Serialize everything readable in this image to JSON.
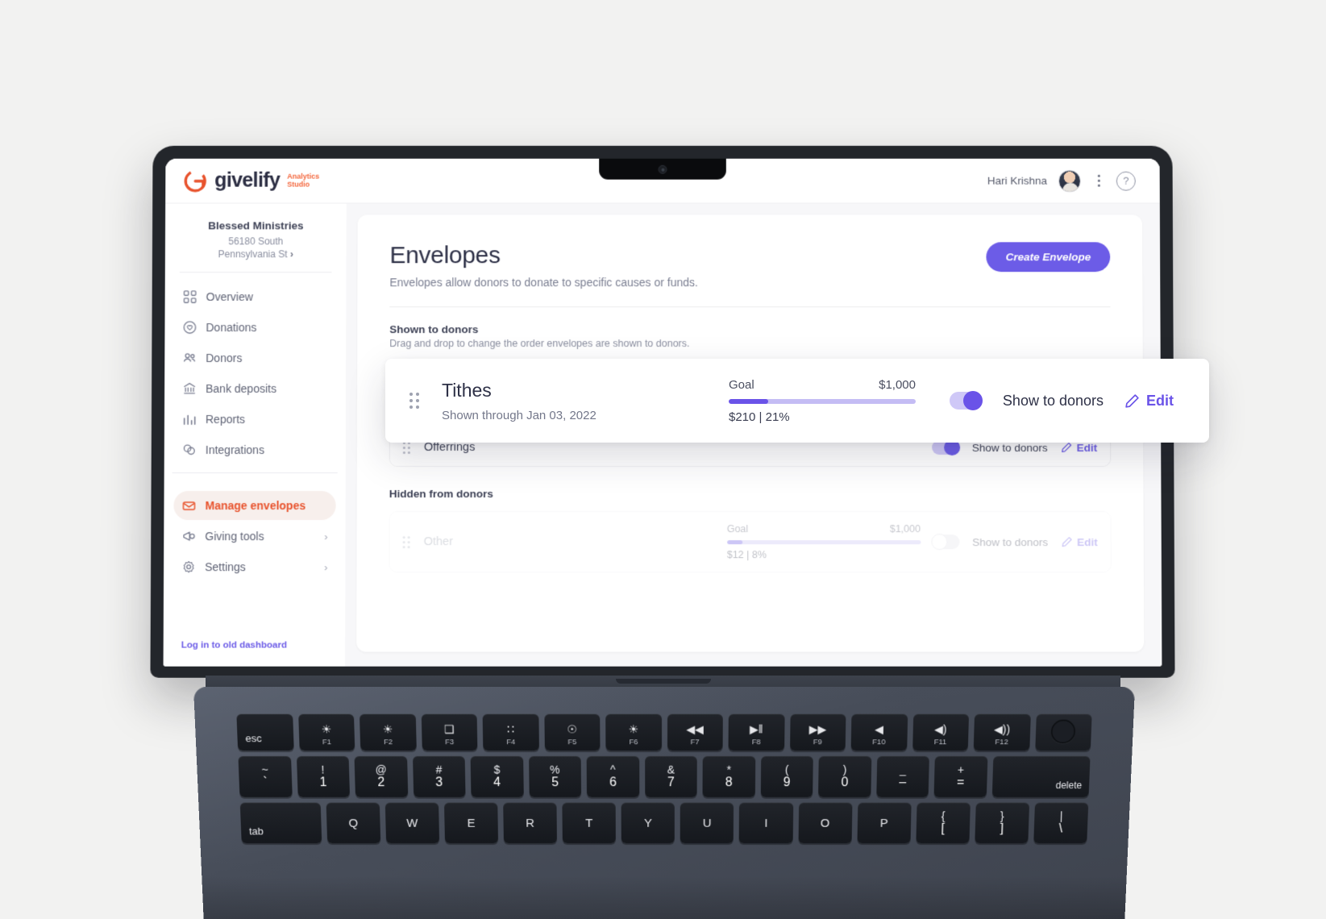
{
  "header": {
    "brand_word": "givelify",
    "brand_sub_line1": "Analytics",
    "brand_sub_line2": "Studio",
    "user_name": "Hari Krishna",
    "avatar_alt": "user-avatar",
    "kebab_label": "More options",
    "help_label": "?"
  },
  "sidebar": {
    "org_name": "Blessed Ministries",
    "org_address_line1": "56180 South",
    "org_address_line2": "Pennsylvania St",
    "org_chevron": "›",
    "items": [
      {
        "label": "Overview",
        "icon": "grid-icon",
        "active": false,
        "chevron": ""
      },
      {
        "label": "Donations",
        "icon": "heart-circle-icon",
        "active": false,
        "chevron": ""
      },
      {
        "label": "Donors",
        "icon": "people-icon",
        "active": false,
        "chevron": ""
      },
      {
        "label": "Bank deposits",
        "icon": "bank-icon",
        "active": false,
        "chevron": ""
      },
      {
        "label": "Reports",
        "icon": "bar-chart-icon",
        "active": false,
        "chevron": ""
      },
      {
        "label": "Integrations",
        "icon": "circles-icon",
        "active": false,
        "chevron": ""
      }
    ],
    "items2": [
      {
        "label": "Manage envelopes",
        "icon": "envelope-icon",
        "active": true,
        "chevron": ""
      },
      {
        "label": "Giving tools",
        "icon": "megaphone-icon",
        "active": false,
        "chevron": "›"
      },
      {
        "label": "Settings",
        "icon": "gear-icon",
        "active": false,
        "chevron": "›"
      }
    ],
    "old_dashboard_link": "Log in to old dashboard"
  },
  "main": {
    "title": "Envelopes",
    "subtitle": "Envelopes allow donors to donate to specific causes or funds.",
    "create_button": "Create Envelope",
    "shown_section": {
      "title": "Shown to donors",
      "subtitle": "Drag and drop to change the order envelopes are shown to donors."
    },
    "hidden_section": {
      "title": "Hidden from donors"
    },
    "rows_shown": [
      {
        "name": "Offerrings",
        "sub": "",
        "goal_label": "",
        "goal_amount": "",
        "progress_text": "",
        "progress_pct": 0,
        "toggle_on": true,
        "toggle_label": "Show to donors",
        "edit_label": "Edit"
      }
    ],
    "rows_hidden": [
      {
        "name": "Other",
        "sub": "",
        "goal_label": "Goal",
        "goal_amount": "$1,000",
        "progress_text": "$12 | 8%",
        "progress_pct": 8,
        "toggle_on": false,
        "toggle_label": "Show to donors",
        "edit_label": "Edit"
      }
    ]
  },
  "float_card": {
    "name": "Tithes",
    "sub": "Shown through Jan 03, 2022",
    "goal_label": "Goal",
    "goal_amount": "$1,000",
    "progress_text": "$210 | 21%",
    "progress_pct": 21,
    "toggle_on": true,
    "toggle_label": "Show to donors",
    "edit_label": "Edit"
  },
  "colors": {
    "accent_purple": "#6c5ce7",
    "brand_orange": "#e8532d",
    "progress_track": "#c4bcf4"
  },
  "keyboard": {
    "fn_row": [
      {
        "main": "esc",
        "sub": "",
        "glyph": "",
        "style": "text-left"
      },
      {
        "main": "",
        "sub": "F1",
        "glyph": "☀",
        "style": "glyph"
      },
      {
        "main": "",
        "sub": "F2",
        "glyph": "☀",
        "style": "glyph"
      },
      {
        "main": "",
        "sub": "F3",
        "glyph": "❑",
        "style": "glyph"
      },
      {
        "main": "",
        "sub": "F4",
        "glyph": "∷",
        "style": "glyph"
      },
      {
        "main": "",
        "sub": "F5",
        "glyph": "☉",
        "style": "glyph"
      },
      {
        "main": "",
        "sub": "F6",
        "glyph": "☀",
        "style": "glyph"
      },
      {
        "main": "",
        "sub": "F7",
        "glyph": "◀◀",
        "style": "glyph"
      },
      {
        "main": "",
        "sub": "F8",
        "glyph": "▶‖",
        "style": "glyph"
      },
      {
        "main": "",
        "sub": "F9",
        "glyph": "▶▶",
        "style": "glyph"
      },
      {
        "main": "",
        "sub": "F10",
        "glyph": "◀",
        "style": "glyph"
      },
      {
        "main": "",
        "sub": "F11",
        "glyph": "◀)",
        "style": "glyph"
      },
      {
        "main": "",
        "sub": "F12",
        "glyph": "◀))",
        "style": "glyph"
      },
      {
        "main": "",
        "sub": "",
        "glyph": "",
        "style": "touchid"
      }
    ],
    "num_row": [
      {
        "up": "~",
        "dn": "`"
      },
      {
        "up": "!",
        "dn": "1"
      },
      {
        "up": "@",
        "dn": "2"
      },
      {
        "up": "#",
        "dn": "3"
      },
      {
        "up": "$",
        "dn": "4"
      },
      {
        "up": "%",
        "dn": "5"
      },
      {
        "up": "^",
        "dn": "6"
      },
      {
        "up": "&",
        "dn": "7"
      },
      {
        "up": "*",
        "dn": "8"
      },
      {
        "up": "(",
        "dn": "9"
      },
      {
        "up": ")",
        "dn": "0"
      },
      {
        "up": "_",
        "dn": "–"
      },
      {
        "up": "+",
        "dn": "="
      }
    ],
    "delete_label": "delete",
    "tab_label": "tab",
    "letter_row": [
      "Q",
      "W",
      "E",
      "R",
      "T",
      "Y",
      "U",
      "I",
      "O",
      "P"
    ],
    "bracket_keys": [
      {
        "up": "{",
        "dn": "["
      },
      {
        "up": "}",
        "dn": "]"
      },
      {
        "up": "|",
        "dn": "\\"
      }
    ]
  }
}
